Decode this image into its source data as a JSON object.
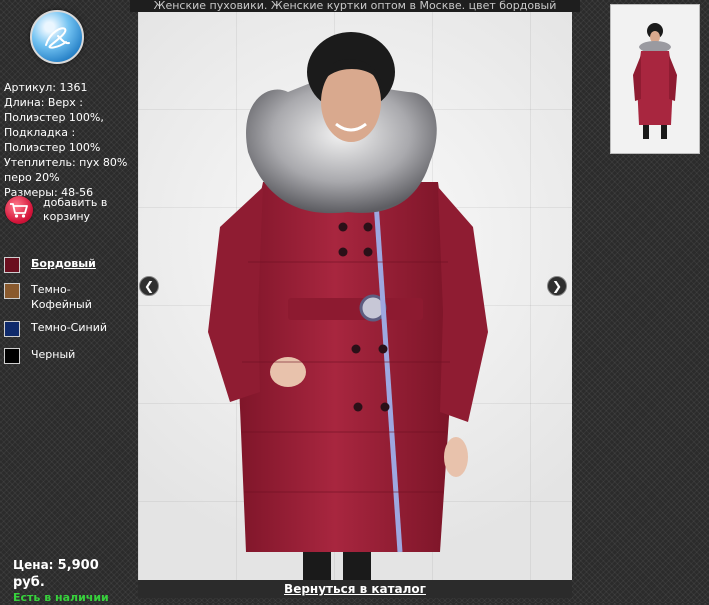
{
  "page": {
    "caption": "Женские пуховики. Женские куртки оптом в Москве. цвет бордовый"
  },
  "product": {
    "specs": [
      "Артикул: 1361",
      "Длина: Верх : Полиэстер 100%, Подкладка : Полиэстер 100%",
      "Утеплитель: пух 80% перо 20%",
      "Размеры: 48-56"
    ],
    "cart_label": "добавить в корзину",
    "price_label": "Цена:",
    "price_value": "5,900 руб.",
    "stock_status": "Есть в наличии"
  },
  "colors": [
    {
      "label": "Бордовый",
      "hex": "#6b0f1f",
      "active": true
    },
    {
      "label": "Темно-Кофейный",
      "hex": "#8a5a2e",
      "active": false
    },
    {
      "label": "Темно-Синий",
      "hex": "#0f2a6b",
      "active": false
    },
    {
      "label": "Черный",
      "hex": "#000000",
      "active": false
    }
  ],
  "gallery": {
    "prev_icon": "chevron-left-icon",
    "next_icon": "chevron-right-icon",
    "back_link": "Вернуться в каталог"
  },
  "theme": {
    "coat_color": "#a8263f",
    "stock_color": "#37d13c"
  }
}
